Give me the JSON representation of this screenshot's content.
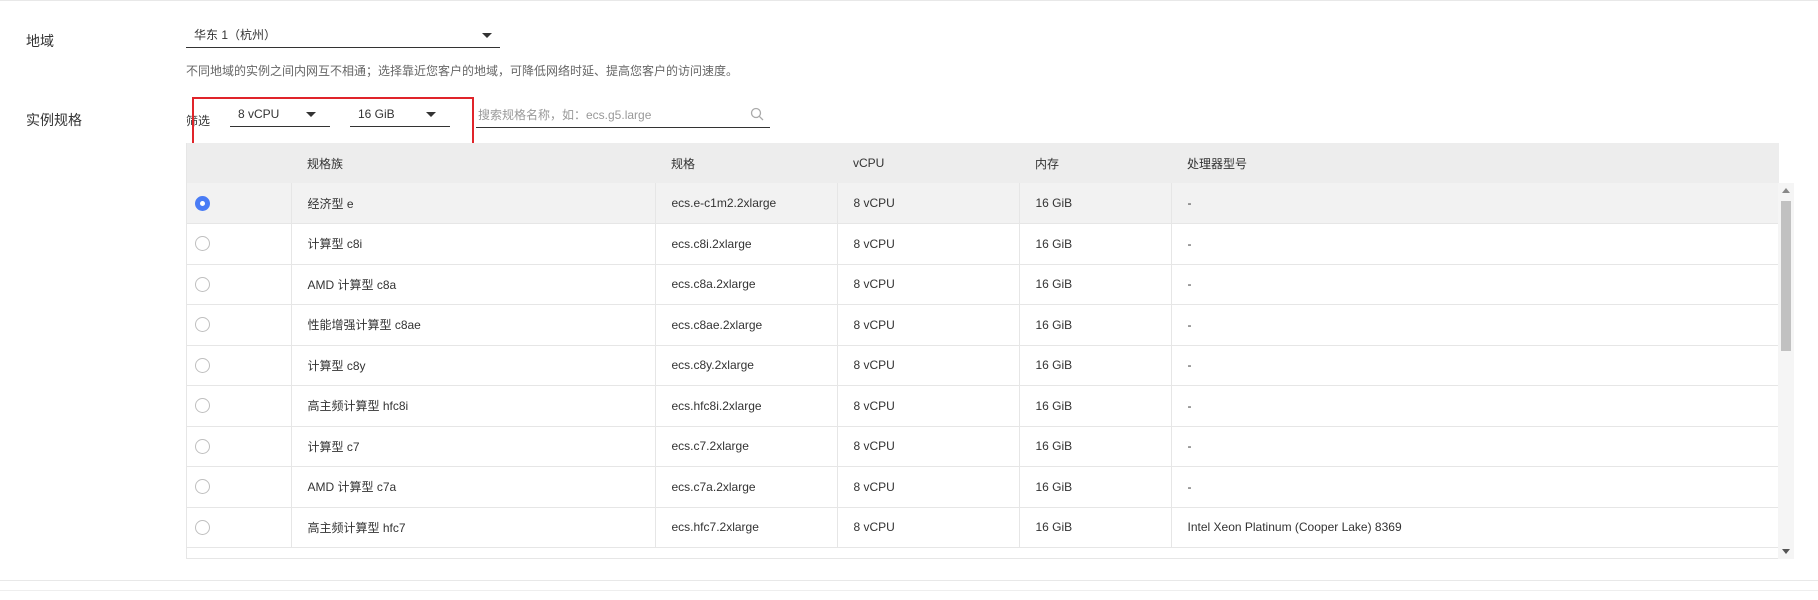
{
  "region": {
    "label": "地域",
    "selected": "华东 1（杭州）",
    "hint": "不同地域的实例之间内网互不相通；选择靠近您客户的地域，可降低网络时延、提高您客户的访问速度。"
  },
  "instance_spec": {
    "label": "实例规格",
    "filter_label": "筛选",
    "vcpu_filter": "8 vCPU",
    "memory_filter": "16 GiB",
    "search_placeholder": "搜索规格名称，如：ecs.g5.large"
  },
  "table": {
    "columns": [
      "规格族",
      "规格",
      "vCPU",
      "内存",
      "处理器型号"
    ],
    "rows": [
      {
        "selected": true,
        "family": "经济型 e",
        "spec": "ecs.e-c1m2.2xlarge",
        "vcpu": "8 vCPU",
        "memory": "16 GiB",
        "cpu": "-"
      },
      {
        "selected": false,
        "family": "计算型 c8i",
        "spec": "ecs.c8i.2xlarge",
        "vcpu": "8 vCPU",
        "memory": "16 GiB",
        "cpu": "-"
      },
      {
        "selected": false,
        "family": "AMD 计算型 c8a",
        "spec": "ecs.c8a.2xlarge",
        "vcpu": "8 vCPU",
        "memory": "16 GiB",
        "cpu": "-"
      },
      {
        "selected": false,
        "family": "性能增强计算型 c8ae",
        "spec": "ecs.c8ae.2xlarge",
        "vcpu": "8 vCPU",
        "memory": "16 GiB",
        "cpu": "-"
      },
      {
        "selected": false,
        "family": "计算型 c8y",
        "spec": "ecs.c8y.2xlarge",
        "vcpu": "8 vCPU",
        "memory": "16 GiB",
        "cpu": "-"
      },
      {
        "selected": false,
        "family": "高主频计算型 hfc8i",
        "spec": "ecs.hfc8i.2xlarge",
        "vcpu": "8 vCPU",
        "memory": "16 GiB",
        "cpu": "-"
      },
      {
        "selected": false,
        "family": "计算型 c7",
        "spec": "ecs.c7.2xlarge",
        "vcpu": "8 vCPU",
        "memory": "16 GiB",
        "cpu": "-"
      },
      {
        "selected": false,
        "family": "AMD 计算型 c7a",
        "spec": "ecs.c7a.2xlarge",
        "vcpu": "8 vCPU",
        "memory": "16 GiB",
        "cpu": "-"
      },
      {
        "selected": false,
        "family": "高主频计算型 hfc7",
        "spec": "ecs.hfc7.2xlarge",
        "vcpu": "8 vCPU",
        "memory": "16 GiB",
        "cpu": "Intel Xeon Platinum (Cooper Lake) 8369"
      }
    ]
  },
  "colors": {
    "accent": "#4a7cf5",
    "highlight_border": "#e0242a",
    "header_bg": "#ededed"
  }
}
